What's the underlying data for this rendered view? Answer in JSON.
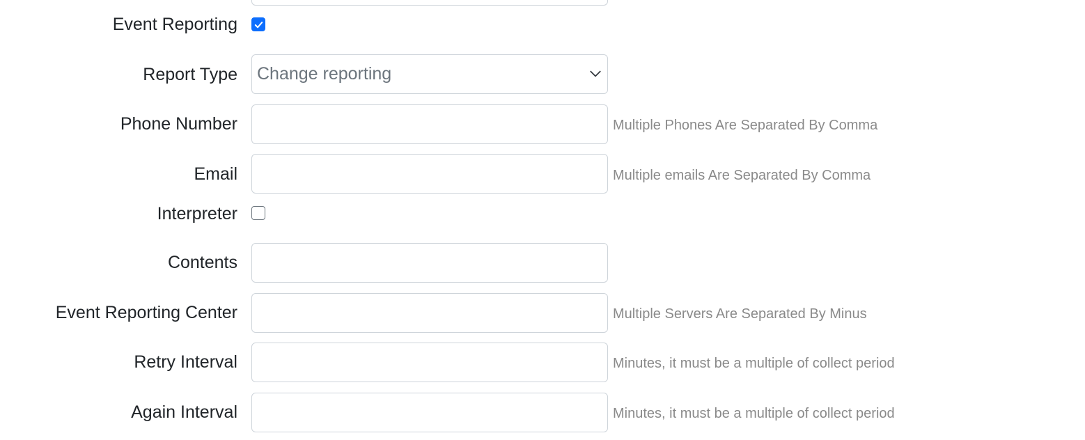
{
  "form": {
    "event_reporting": {
      "label": "Event Reporting",
      "checked": true
    },
    "report_type": {
      "label": "Report Type",
      "value": "Change reporting"
    },
    "phone_number": {
      "label": "Phone Number",
      "value": "",
      "hint": "Multiple Phones Are Separated By Comma"
    },
    "email": {
      "label": "Email",
      "value": "",
      "hint": "Multiple emails Are Separated By Comma"
    },
    "interpreter": {
      "label": "Interpreter",
      "checked": false
    },
    "contents": {
      "label": "Contents",
      "value": ""
    },
    "event_reporting_center": {
      "label": "Event Reporting Center",
      "value": "",
      "hint": "Multiple Servers Are Separated By Minus"
    },
    "retry_interval": {
      "label": "Retry Interval",
      "value": "",
      "hint": "Minutes, it must be a multiple of collect period"
    },
    "again_interval": {
      "label": "Again Interval",
      "value": "",
      "hint": "Minutes, it must be a multiple of collect period"
    }
  },
  "icons": {
    "select_arrow": "chevron-down-icon",
    "check": "checkmark-icon"
  },
  "colors": {
    "accent": "#0d6efd",
    "hint_text": "#8a8a8a",
    "border": "#ced4da"
  }
}
